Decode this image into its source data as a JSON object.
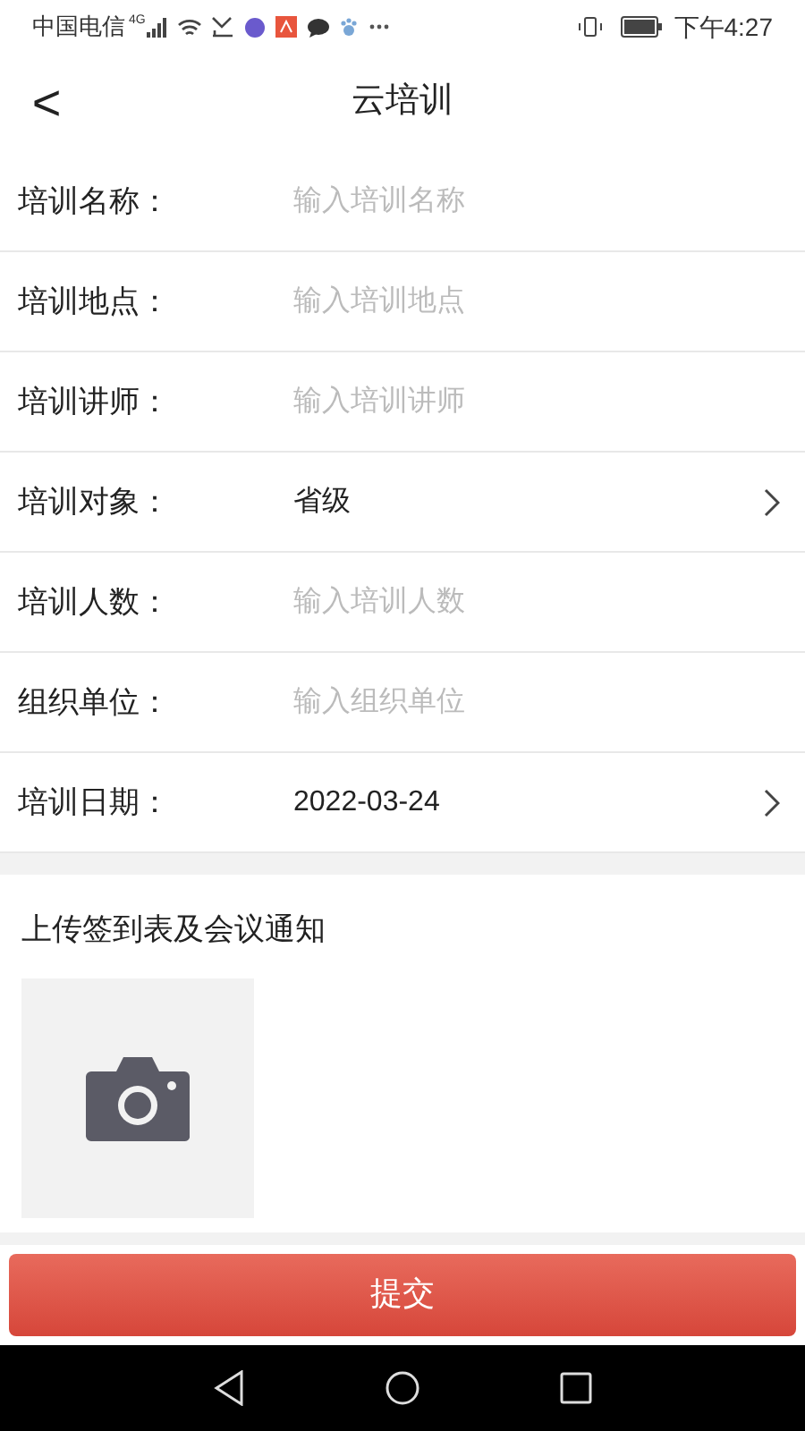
{
  "status_bar": {
    "carrier": "中国电信",
    "network": "4G",
    "time": "下午4:27"
  },
  "header": {
    "back": "<",
    "title": "云培训"
  },
  "fields": [
    {
      "label": "培训名称：",
      "kind": "input",
      "placeholder": "输入培训名称"
    },
    {
      "label": "培训地点：",
      "kind": "input",
      "placeholder": "输入培训地点"
    },
    {
      "label": "培训讲师：",
      "kind": "input",
      "placeholder": "输入培训讲师"
    },
    {
      "label": "培训对象：",
      "kind": "select",
      "value": "省级"
    },
    {
      "label": "培训人数：",
      "kind": "input",
      "placeholder": "输入培训人数"
    },
    {
      "label": "组织单位：",
      "kind": "input",
      "placeholder": "输入组织单位"
    },
    {
      "label": "培训日期：",
      "kind": "select",
      "value": "2022-03-24"
    }
  ],
  "upload": {
    "title": "上传签到表及会议通知"
  },
  "submit": "提交"
}
